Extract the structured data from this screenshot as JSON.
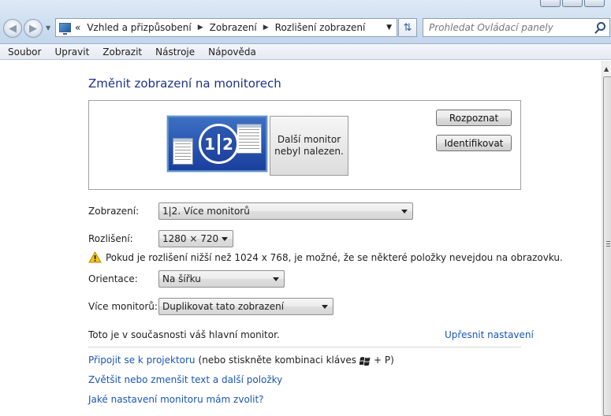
{
  "address_bar": {
    "breadcrumbs": [
      "Vzhled a přizpůsobení",
      "Zobrazení",
      "Rozlišení zobrazení"
    ],
    "prefix": "«"
  },
  "search": {
    "placeholder": "Prohledat Ovládací panely"
  },
  "menu": [
    "Soubor",
    "Upravit",
    "Zobrazit",
    "Nástroje",
    "Nápověda"
  ],
  "page": {
    "heading": "Změnit zobrazení na monitorech",
    "monitor_badge": [
      "1",
      "2"
    ],
    "monitor2_text_line1": "Další monitor",
    "monitor2_text_line2": "nebyl nalezen.",
    "detect_button": "Rozpoznat",
    "identify_button": "Identifikovat"
  },
  "settings": {
    "display_label": "Zobrazení:",
    "display_value": "1|2. Více monitorů",
    "resolution_label": "Rozlišení:",
    "resolution_value": "1280 × 720",
    "warning": "Pokud je rozlišení nižší než 1024 x 768, je možné, že se některé položky nevejdou na obrazovku.",
    "orientation_label": "Orientace:",
    "orientation_value": "Na šířku",
    "multiple_label": "Více monitorů:",
    "multiple_value": "Duplikovat tato zobrazení"
  },
  "footer": {
    "main_monitor_note": "Toto je v současnosti váš hlavní monitor.",
    "advanced_link": "Upřesnit nastavení",
    "projector_link": "Připojit se k projektoru",
    "projector_hint_before": "(nebo stiskněte kombinaci kláves",
    "projector_hint_after": "+ P)",
    "text_size_link": "Zvětšit nebo zmenšit text a další položky",
    "which_settings_link": "Jaké nastavení monitoru mám zvolit?"
  },
  "colors": {
    "link": "#1a56b3",
    "heading": "#1e3287",
    "warning": "#f2c200"
  }
}
